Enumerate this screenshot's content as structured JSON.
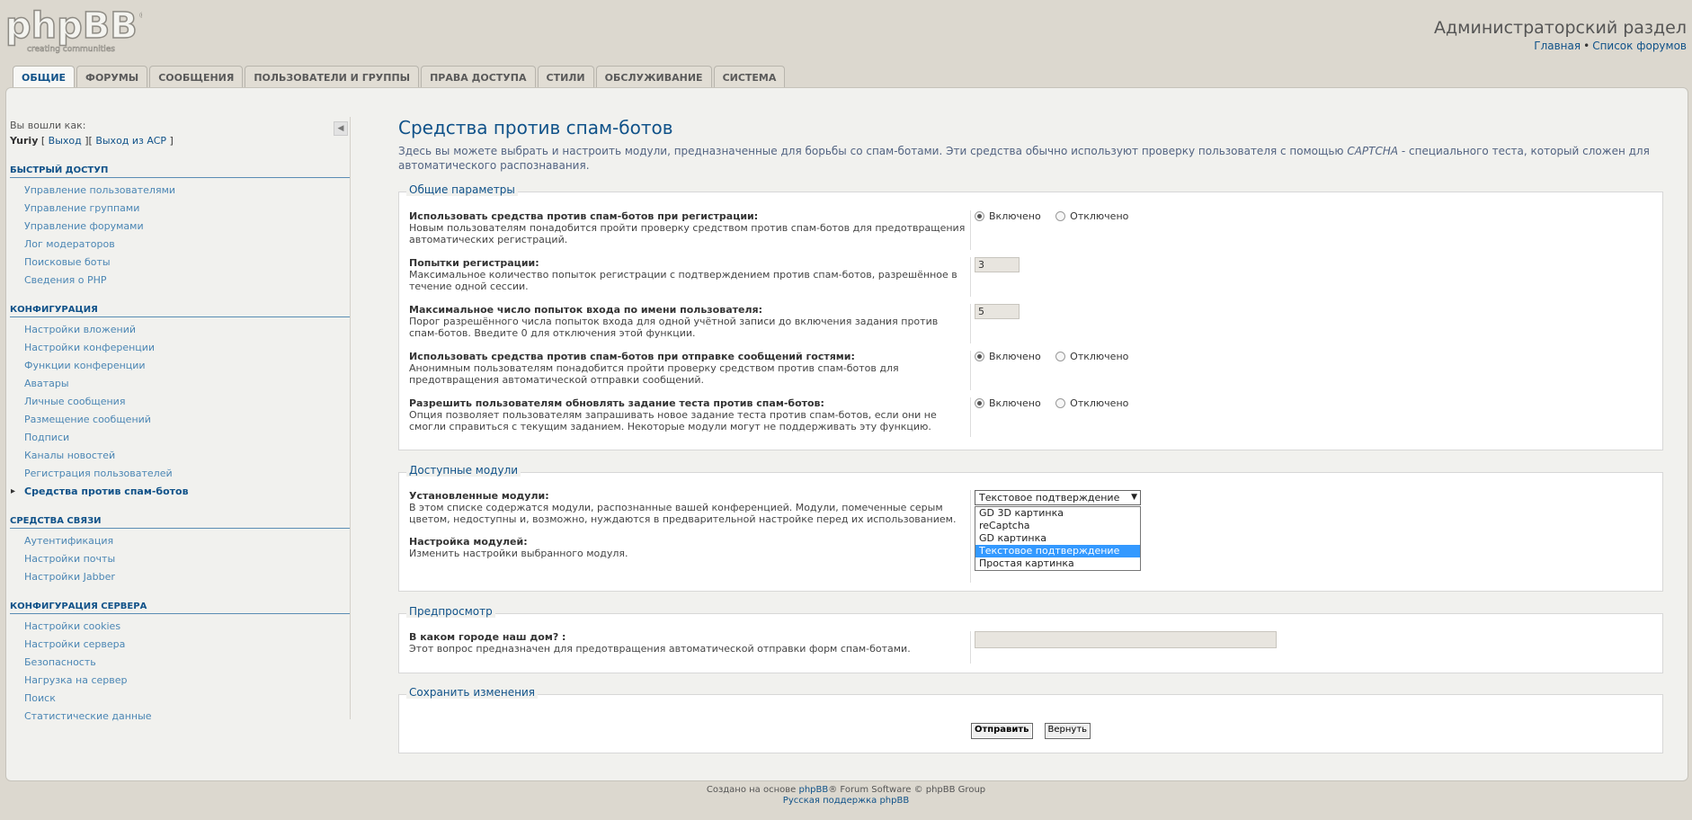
{
  "header": {
    "logo_text": "phpBB",
    "logo_tagline": "creating communities",
    "acp_title": "Администраторский раздел",
    "links": [
      "Главная",
      "Список форумов"
    ],
    "link_separator": "•"
  },
  "tabs": [
    {
      "label": "Общие",
      "active": true
    },
    {
      "label": "Форумы"
    },
    {
      "label": "Сообщения"
    },
    {
      "label": "Пользователи и группы"
    },
    {
      "label": "Права доступа"
    },
    {
      "label": "Стили"
    },
    {
      "label": "Обслуживание"
    },
    {
      "label": "Система"
    }
  ],
  "sidebar": {
    "logged_in_label": "Вы вошли как:",
    "username": "Yuriy",
    "logout": "Выход",
    "leave_acp": "Выход из ACP",
    "sections": [
      {
        "title": "Быстрый доступ",
        "items": [
          "Управление пользователями",
          "Управление группами",
          "Управление форумами",
          "Лог модераторов",
          "Поисковые боты",
          "Сведения о PHP"
        ]
      },
      {
        "title": "Конфигурация",
        "items": [
          "Настройки вложений",
          "Настройки конференции",
          "Функции конференции",
          "Аватары",
          "Личные сообщения",
          "Размещение сообщений",
          "Подписи",
          "Каналы новостей",
          "Регистрация пользователей",
          "Средства против спам-ботов"
        ]
      },
      {
        "title": "Средства связи",
        "items": [
          "Аутентификация",
          "Настройки почты",
          "Настройки Jabber"
        ]
      },
      {
        "title": "Конфигурация сервера",
        "items": [
          "Настройки cookies",
          "Настройки сервера",
          "Безопасность",
          "Нагрузка на сервер",
          "Поиск",
          "Статистические данные"
        ]
      }
    ],
    "active_item": "Средства против спам-ботов"
  },
  "main": {
    "title": "Средства против спам-ботов",
    "description_1": "Здесь вы можете выбрать и настроить модули, предназначенные для борьбы со спам-ботами. Эти средства обычно используют проверку пользователя с помощью ",
    "description_captcha": "CAPTCHA",
    "description_2": " - специального теста, который сложен для автоматического распознавания."
  },
  "general": {
    "legend": "Общие параметры",
    "enabled_label": "Включено",
    "disabled_label": "Отключено",
    "rows": [
      {
        "title": "Использовать средства против спам-ботов при регистрации:",
        "explain": "Новым пользователям понадобится пройти проверку средством против спам-ботов для предотвращения автоматических регистраций.",
        "value": "enabled"
      },
      {
        "title": "Попытки регистрации:",
        "explain": "Максимальное количество попыток регистрации с подтверждением против спам-ботов, разрешённое в течение одной сессии.",
        "value": "3"
      },
      {
        "title": "Максимальное число попыток входа по имени пользователя:",
        "explain": "Порог разрешённого числа попыток входа для одной учётной записи до включения задания против спам-ботов. Введите 0 для отключения этой функции.",
        "value": "5"
      },
      {
        "title": "Использовать средства против спам-ботов при отправке сообщений гостями:",
        "explain": "Анонимным пользователям понадобится пройти проверку средством против спам-ботов для предотвращения автоматической отправки сообщений.",
        "value": "enabled"
      },
      {
        "title": "Разрешить пользователям обновлять задание теста против спам-ботов:",
        "explain": "Опция позволяет пользователям запрашивать новое задание теста против спам-ботов, если они не смогли справиться с текущим заданием. Некоторые модули могут не поддерживать эту функцию.",
        "value": "enabled"
      }
    ]
  },
  "modules": {
    "legend": "Доступные модули",
    "installed_title": "Установленные модули:",
    "installed_explain": "В этом списке содержатся модули, распознанные вашей конференцией. Модули, помеченные серым цветом, недоступны и, возможно, нуждаются в предварительной настройке перед их использованием.",
    "config_title": "Настройка модулей:",
    "config_explain": "Изменить настройки выбранного модуля.",
    "selected": "Текстовое подтверждение",
    "options": [
      "GD 3D картинка",
      "reCaptcha",
      "GD картинка",
      "Текстовое подтверждение",
      "Простая картинка"
    ]
  },
  "preview": {
    "legend": "Предпросмотр",
    "question": "В каком городе наш дом? :",
    "explain": "Этот вопрос предназначен для предотвращения автоматической отправки форм спам-ботами.",
    "answer": ""
  },
  "save": {
    "legend": "Сохранить изменения",
    "submit": "Отправить",
    "reset": "Вернуть"
  },
  "footer": {
    "line1_pre": "Создано на основе ",
    "line1_link": "phpBB",
    "line1_post": "® Forum Software © phpBB Group",
    "line2": "Русская поддержка phpBB"
  },
  "colors": {
    "link": "#105289",
    "menu_link": "#4b86b4",
    "background": "#dcd8cf",
    "highlight": "#3399ff"
  }
}
